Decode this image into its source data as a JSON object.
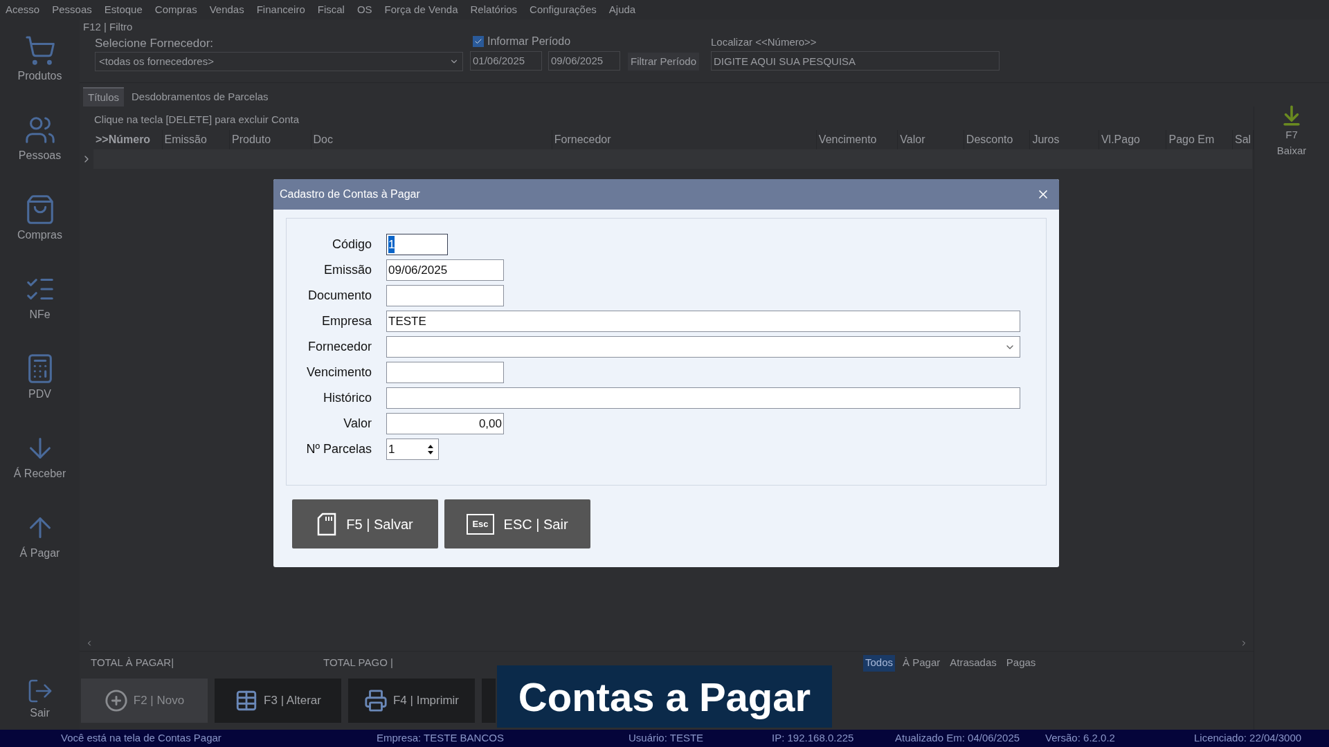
{
  "menu": [
    "Acesso",
    "Pessoas",
    "Estoque",
    "Compras",
    "Vendas",
    "Financeiro",
    "Fiscal",
    "OS",
    "Força de Venda",
    "Relatórios",
    "Configurações",
    "Ajuda"
  ],
  "sidebar": [
    {
      "label": "Produtos",
      "kind": "cart"
    },
    {
      "label": "Pessoas",
      "kind": "people"
    },
    {
      "label": "Compras",
      "kind": "bag"
    },
    {
      "label": "NFe",
      "kind": "checklist"
    },
    {
      "label": "PDV",
      "kind": "pos"
    },
    {
      "label": "Á Receber",
      "kind": "down"
    },
    {
      "label": "Á Pagar",
      "kind": "up"
    }
  ],
  "exit": {
    "label": "Sair"
  },
  "filter": {
    "title": "F12 | Filtro",
    "supplier_label": "Selecione Fornecedor:",
    "supplier_value": "<todas os fornecedores>",
    "period": {
      "label": "Informar Período",
      "checked": true
    },
    "date_from": "01/06/2025",
    "date_to": "09/06/2025",
    "filter_button": "Filtrar Período",
    "search_label": "Localizar <<Número>>",
    "search_placeholder": "DIGITE AQUI SUA PESQUISA"
  },
  "tabs": [
    {
      "label": "Títulos",
      "selected": true
    },
    {
      "label": "Desdobramentos de Parcelas",
      "selected": false
    }
  ],
  "hint": "Clique na tecla [DELETE] para excluir Conta",
  "table": {
    "columns": [
      ">>Número",
      "Emissão",
      "Produto",
      "Doc",
      "Fornecedor",
      "Vencimento",
      "Valor",
      "Desconto",
      "Juros",
      "Vl.Pago",
      "Pago Em",
      "Sal"
    ]
  },
  "side_action": {
    "key": "F7",
    "label": "Baixar"
  },
  "totals": [
    "TOTAL À PAGAR|",
    "TOTAL PAGO |"
  ],
  "status_filters": [
    {
      "label": "Todos",
      "selected": true
    },
    {
      "label": "À Pagar",
      "selected": false
    },
    {
      "label": "Atrasadas",
      "selected": false
    },
    {
      "label": "Pagas",
      "selected": false
    }
  ],
  "actions": [
    {
      "label": "F2 | Novo",
      "kind": "new",
      "disabled": true
    },
    {
      "label": "F3 | Alterar",
      "kind": "edit",
      "disabled": false
    },
    {
      "label": "F4 | Imprimir",
      "kind": "print",
      "disabled": false
    }
  ],
  "status_bar": [
    "Você está na tela de Contas Pagar",
    "Empresa: TESTE BANCOS",
    "Usuário: TESTE",
    "IP: 192.168.0.225",
    "Atualizado Em: 04/06/2025",
    "Versão: 6.2.0.2",
    "Licenciado: 22/04/3000"
  ],
  "dialog": {
    "title": "Cadastro de Contas à Pagar",
    "fields": [
      {
        "label": "Código",
        "kind": "code",
        "value": "1",
        "focused": true
      },
      {
        "label": "Emissão",
        "kind": "date",
        "value": "09/06/2025",
        "focused": false
      },
      {
        "label": "Documento",
        "kind": "date",
        "focused": false
      },
      {
        "label": "Empresa",
        "kind": "wide",
        "value": "TESTE",
        "focused": false
      },
      {
        "label": "Fornecedor",
        "kind": "combo",
        "focused": false
      },
      {
        "label": "Vencimento",
        "kind": "date",
        "focused": false
      },
      {
        "label": "Histórico",
        "kind": "wide",
        "focused": false
      },
      {
        "label": "Valor",
        "kind": "money",
        "value": "0,00",
        "focused": false
      },
      {
        "label": "Nº Parcelas",
        "kind": "spin",
        "value": "1",
        "focused": false
      }
    ],
    "buttons": [
      {
        "label": "F5 | Salvar",
        "kind": "save"
      },
      {
        "label": "ESC | Sair",
        "kind": "esc",
        "icon_text": "Esc"
      }
    ]
  },
  "caption": "Contas a Pagar"
}
